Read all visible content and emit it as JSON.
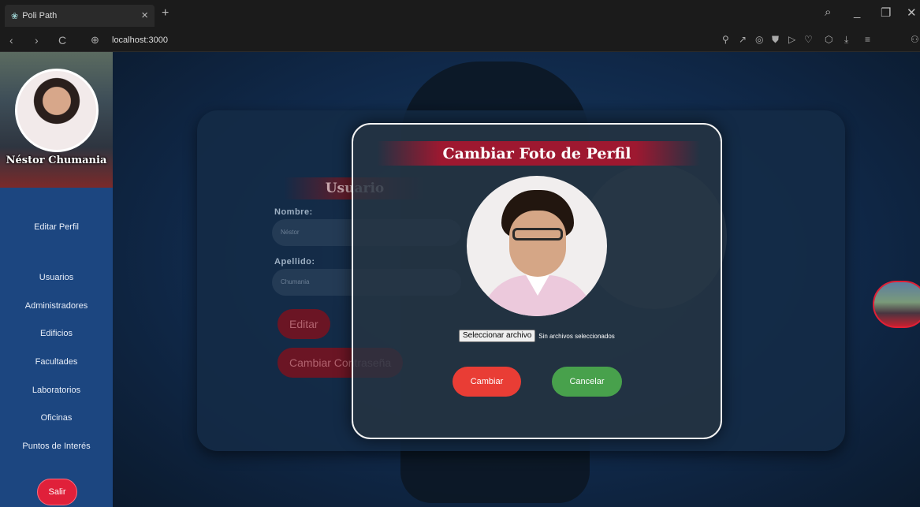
{
  "browser": {
    "tab_title": "Poli Path",
    "tab_close": "×",
    "new_tab": "+",
    "url": "localhost:3000",
    "nav": {
      "back": "‹",
      "forward": "›",
      "reload": "C"
    }
  },
  "sidebar": {
    "user_name": "Néstor Chumania",
    "items": [
      {
        "label": "Editar Perfil"
      },
      {
        "label": "Usuarios"
      },
      {
        "label": "Administradores"
      },
      {
        "label": "Edificios"
      },
      {
        "label": "Facultades"
      },
      {
        "label": "Laboratorios"
      },
      {
        "label": "Oficinas"
      },
      {
        "label": "Puntos de Interés"
      }
    ],
    "logout_label": "Salir"
  },
  "profile_form": {
    "title": "Usuario",
    "nombre_label": "Nombre:",
    "nombre_value": "Néstor",
    "apellido_label": "Apellido:",
    "apellido_value": "Chumania",
    "edit_label": "Editar",
    "change_password_label": "Cambiar Contraseña"
  },
  "modal": {
    "title": "Cambiar Foto de Perfil",
    "file_button": "Seleccionar archivo",
    "file_status": "Sin archivos seleccionados",
    "confirm_label": "Cambiar",
    "cancel_label": "Cancelar"
  },
  "colors": {
    "sidebar": "#1c4680",
    "logout": "#e0203a",
    "confirm": "#e93d35",
    "cancel": "#48a14c",
    "title_band": "#9e1830"
  }
}
